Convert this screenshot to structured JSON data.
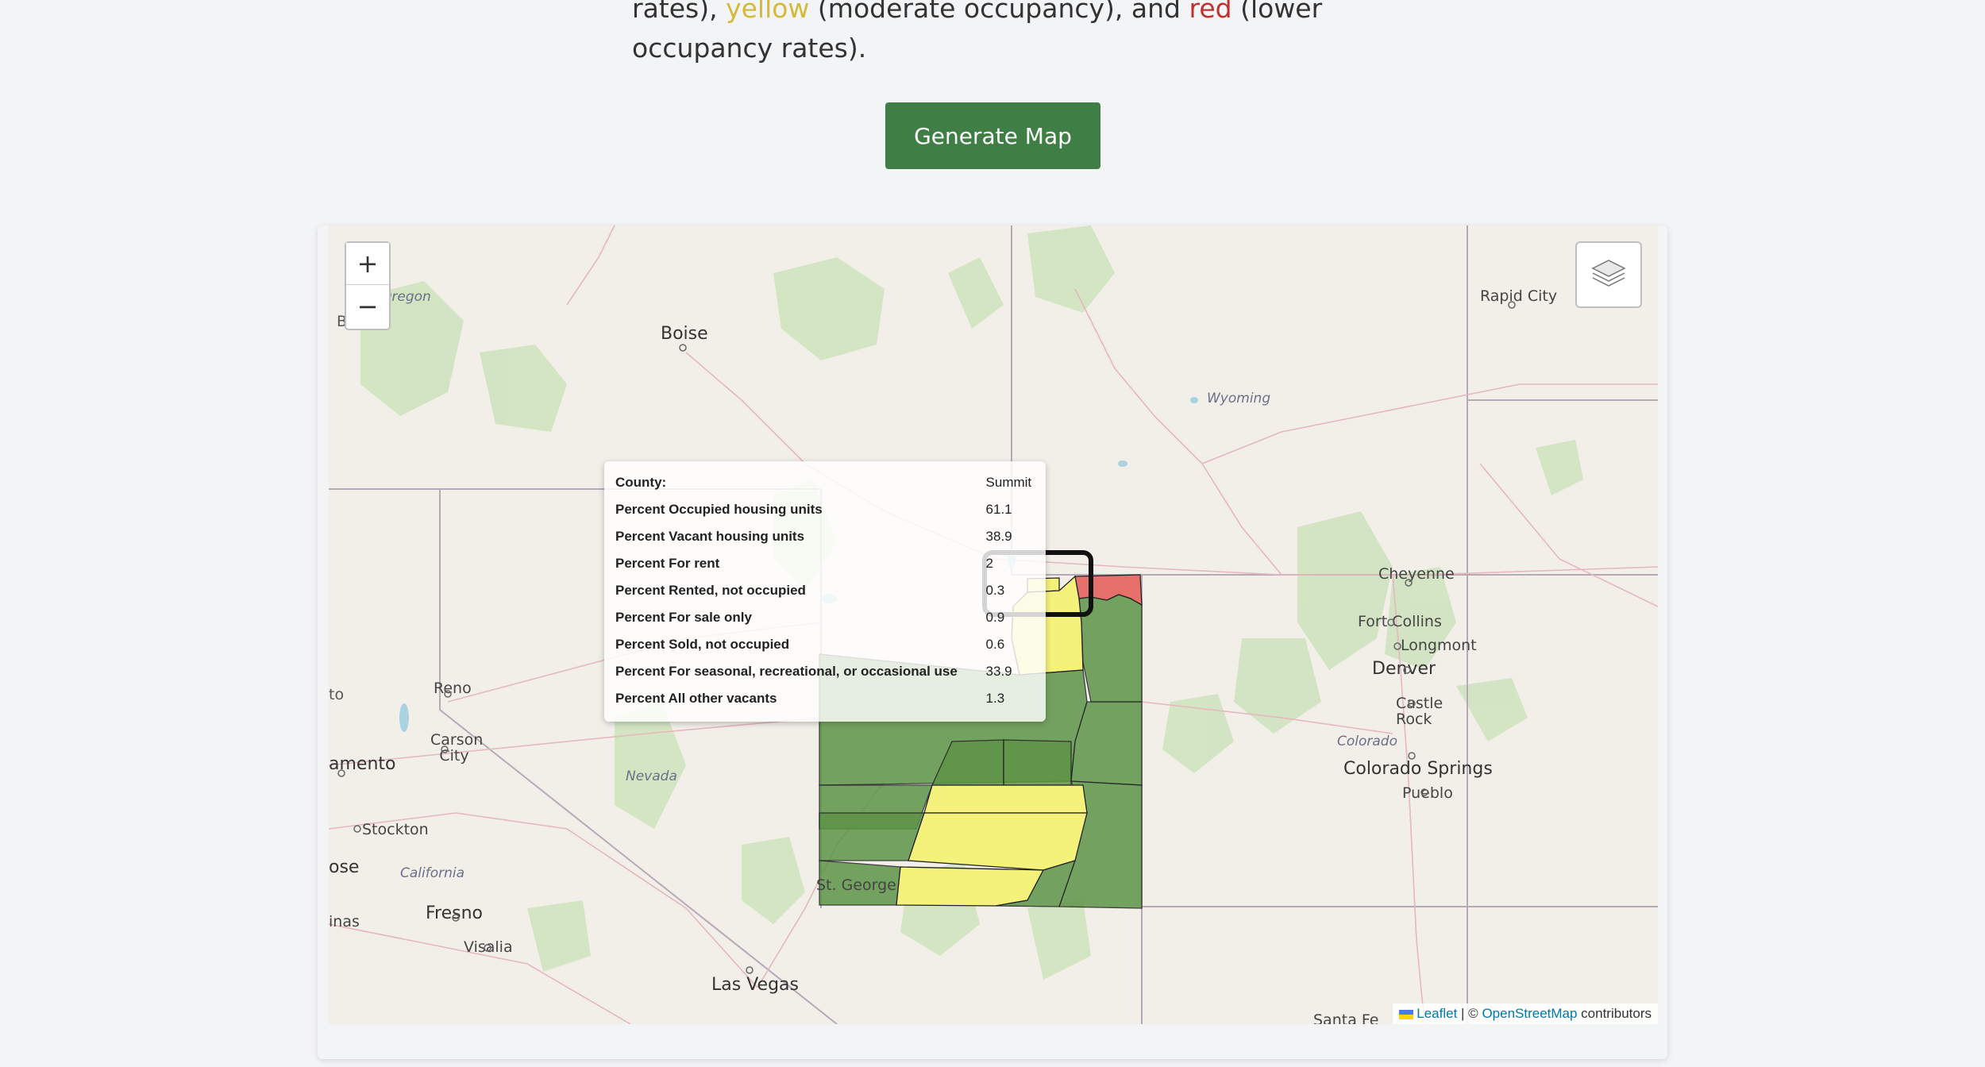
{
  "intro": {
    "part1": "rates), ",
    "yellow_word": "yellow",
    "part2": " (moderate occupancy), and ",
    "red_word": "red",
    "part3": " (lower",
    "line2": "occupancy rates)."
  },
  "generate_button": {
    "label": "Generate Map"
  },
  "map": {
    "zoom_in": "+",
    "zoom_out": "−",
    "labels": {
      "oregon": "Oregon",
      "boise": "Boise",
      "wyoming": "Wyoming",
      "rapid_city": "Rapid City",
      "cheyenne": "Cheyenne",
      "fort_collins": "Fort Collins",
      "longmont": "Longmont",
      "denver": "Denver",
      "castle_rock": "Castle Rock",
      "colorado": "Colorado",
      "colorado_springs": "Colorado Springs",
      "pueblo": "Pueblo",
      "reno": "Reno",
      "carson_city": "Carson City",
      "sacramento": "amento",
      "nevada": "Nevada",
      "stockton": "Stockton",
      "san_jose": "ose",
      "california": "California",
      "fresno": "Fresno",
      "salinas": "inas",
      "visalia": "Visalia",
      "las_vegas": "Las Vegas",
      "st_george": "St. George",
      "santa_fe": "Santa Fe",
      "b_edge": "B",
      "to_edge": "to"
    },
    "legend_colors": {
      "high": "#4f8a3c",
      "moderate": "#f4f27a",
      "low": "#e8706a"
    },
    "attribution": {
      "leaflet": "Leaflet",
      "separator": " | © ",
      "osm": "OpenStreetMap",
      "contributors": " contributors"
    }
  },
  "popup": {
    "rows": [
      {
        "label": "County:",
        "value": "Summit"
      },
      {
        "label": "Percent Occupied housing units",
        "value": "61.1"
      },
      {
        "label": "Percent Vacant housing units",
        "value": "38.9"
      },
      {
        "label": "Percent For rent",
        "value": "2"
      },
      {
        "label": "Percent Rented, not occupied",
        "value": "0.3"
      },
      {
        "label": "Percent For sale only",
        "value": "0.9"
      },
      {
        "label": "Percent Sold, not occupied",
        "value": "0.6"
      },
      {
        "label": "Percent For seasonal, recreational, or occasional use",
        "value": "33.9"
      },
      {
        "label": "Percent All other vacants",
        "value": "1.3"
      }
    ]
  }
}
